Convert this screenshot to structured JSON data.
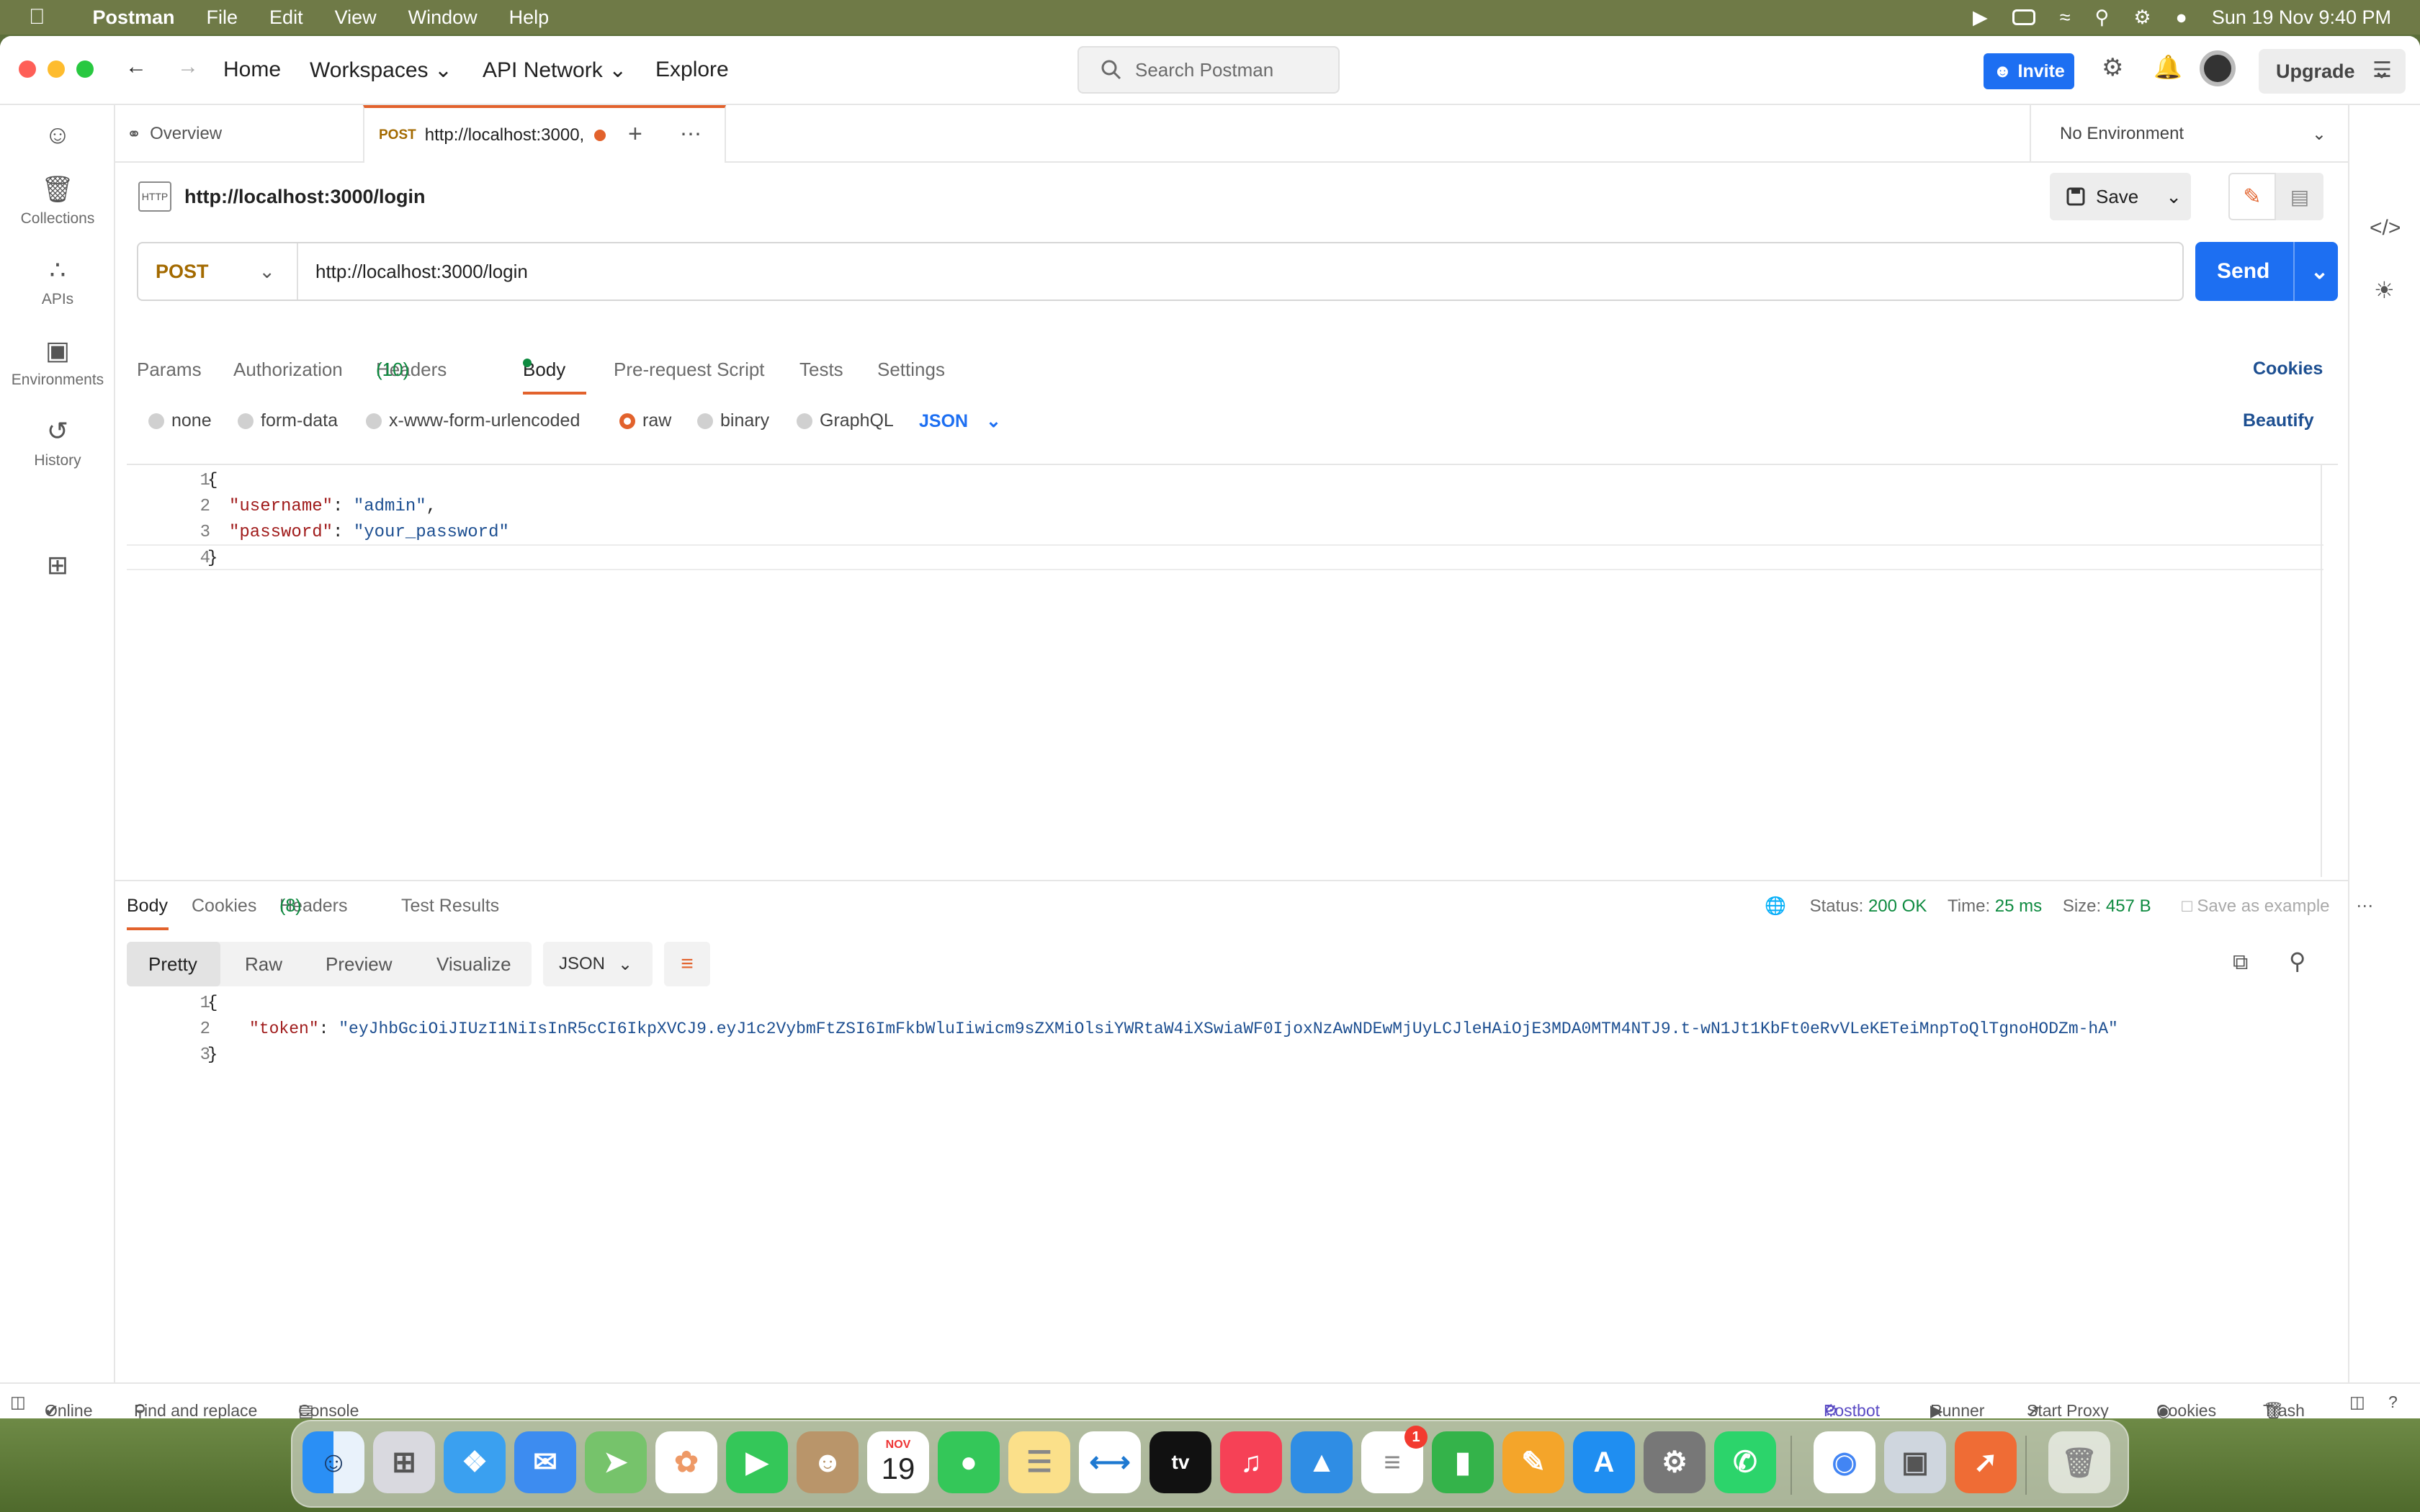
{
  "menubar": {
    "app_name": "Postman",
    "items": [
      "File",
      "Edit",
      "View",
      "Window",
      "Help"
    ],
    "datetime": "Sun 19 Nov  9:40 PM"
  },
  "titlebar": {
    "home": "Home",
    "workspaces": "Workspaces",
    "api_network": "API Network",
    "explore": "Explore",
    "search_placeholder": "Search Postman",
    "invite": "Invite",
    "upgrade": "Upgrade"
  },
  "sidebar": {
    "items": [
      {
        "label": "Collections"
      },
      {
        "label": "APIs"
      },
      {
        "label": "Environments"
      },
      {
        "label": "History"
      }
    ]
  },
  "tabs": {
    "overview": "Overview",
    "active_method": "POST",
    "active_url": "http://localhost:3000,"
  },
  "environment": "No Environment",
  "request": {
    "title": "http://localhost:3000/login",
    "http_badge": "HTTP",
    "save": "Save",
    "method": "POST",
    "url": "http://localhost:3000/login",
    "send": "Send",
    "tabs": {
      "params": "Params",
      "authorization": "Authorization",
      "headers": "Headers",
      "headers_count": "(10)",
      "body": "Body",
      "prerequest": "Pre-request Script",
      "tests": "Tests",
      "settings": "Settings"
    },
    "cookies": "Cookies",
    "body_options": [
      "none",
      "form-data",
      "x-www-form-urlencoded",
      "raw",
      "binary",
      "GraphQL"
    ],
    "body_format": "JSON",
    "beautify": "Beautify",
    "code_lines": [
      "{",
      "\"username\": \"admin\",",
      "\"password\": \"your_password\"",
      "}"
    ],
    "line_numbers": [
      "1",
      "2",
      "3",
      "4"
    ],
    "key_username": "\"username\"",
    "val_username": "\"admin\"",
    "key_password": "\"password\"",
    "val_password": "\"your_password\""
  },
  "response": {
    "tabs": {
      "body": "Body",
      "cookies": "Cookies",
      "headers": "Headers",
      "headers_count": "(8)",
      "test_results": "Test Results"
    },
    "status_label": "Status:",
    "status_value": "200 OK",
    "time_label": "Time:",
    "time_value": "25 ms",
    "size_label": "Size:",
    "size_value": "457 B",
    "save_example": "Save as example",
    "views": [
      "Pretty",
      "Raw",
      "Preview",
      "Visualize"
    ],
    "format": "JSON",
    "line_numbers": [
      "1",
      "2",
      "3"
    ],
    "token_key": "\"token\"",
    "token_value": "\"eyJhbGciOiJIUzI1NiIsInR5cCI6IkpXVCJ9.eyJ1c2VybmFtZSI6ImFkbWluIiwicm9sZXMiOlsiYWRtaW4iXSwiaWF0IjoxNzAwNDEwMjUyLCJleHAiOjE3MDA0MTM4NTJ9.t-wN1Jt1KbFt0eRvVLeKETeiMnpToQlTgnoHODZm-hA\""
  },
  "footer": {
    "online": "Online",
    "find_replace": "Find and replace",
    "console": "Console",
    "postbot": "Postbot",
    "runner": "Runner",
    "start_proxy": "Start Proxy",
    "cookies": "Cookies",
    "trash": "Trash"
  },
  "dock": {
    "calendar_month": "NOV",
    "calendar_day": "19",
    "reminders_badge": "1"
  },
  "colors": {
    "accent": "#1d6ff2",
    "postman_orange": "#e2622c",
    "ok_green": "#0d8a3f",
    "json_key": "#a01b1b",
    "json_string": "#1d4f91"
  }
}
